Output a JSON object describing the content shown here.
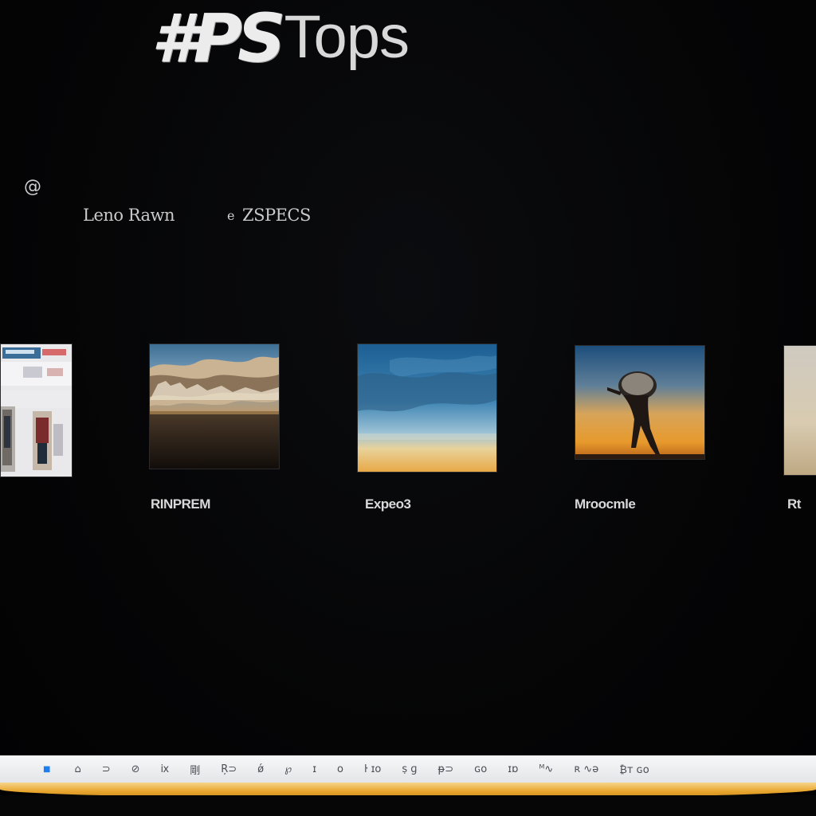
{
  "app": {
    "title_bold": "#PS",
    "title_light": "Tops"
  },
  "toolbar": {
    "at_symbol": "@",
    "filters": [
      {
        "bullet": "",
        "label": "Leno Rawn"
      },
      {
        "bullet": "e",
        "label": "ZSPECS"
      }
    ]
  },
  "gallery": {
    "items": [
      {
        "caption": ""
      },
      {
        "caption": "RINPREM"
      },
      {
        "caption": "Expeo3"
      },
      {
        "caption": "Mroocmle"
      },
      {
        "caption": "Rt"
      }
    ]
  },
  "taskbar": {
    "items": [
      "■",
      "⌂",
      "⊃",
      "⊘",
      "ⅸ",
      "剛",
      "Ŗ⊃",
      "ǿ",
      "℘",
      "ɪ",
      "ᴏ",
      "ŀ ɪo",
      "ṣ ɡ",
      "ᵽ⊃",
      "ɢo",
      "ɪɒ",
      "ᴹ∿",
      "ʀ ∿ə",
      "₿ᴛ ɢo"
    ]
  },
  "colors": {
    "background": "#050506",
    "taskbar": "#eef0f2",
    "accent_strip": "#e8a62e",
    "start_icon": "#1d7ef0"
  }
}
